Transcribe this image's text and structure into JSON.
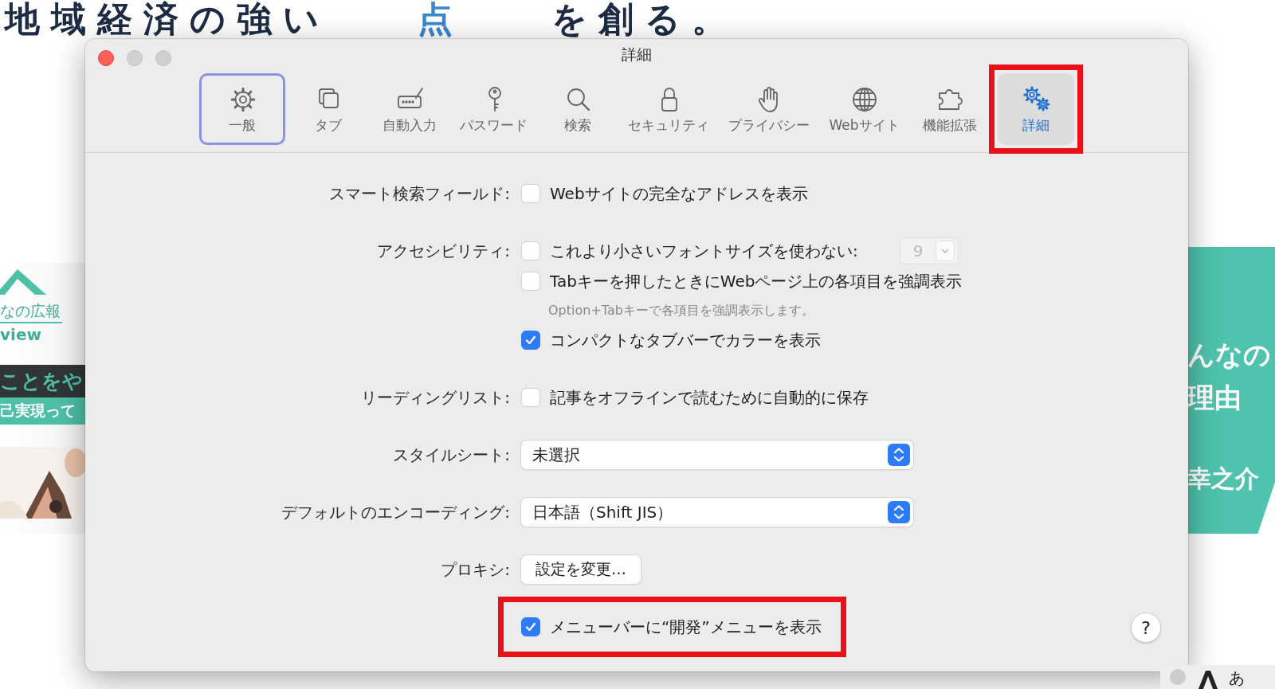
{
  "page": {
    "headline": [
      {
        "text": "地域経済の強い",
        "accent": false
      },
      {
        "text": "点",
        "accent": true
      },
      {
        "text": "を創る。",
        "accent": false
      }
    ],
    "left_banner": {
      "caption": "なの広報",
      "subcaption": "view",
      "band_dark": "ことをや",
      "band_teal": "己実現って"
    },
    "right_banner": {
      "lines": [
        "んなの",
        "理由",
        "幸之介"
      ]
    },
    "corner_panel": {
      "text": "あ"
    }
  },
  "window": {
    "title": "詳細"
  },
  "tabs": [
    {
      "label": "一般",
      "selected": false,
      "focused": true,
      "highlighted": false
    },
    {
      "label": "タブ",
      "selected": false,
      "focused": false,
      "highlighted": false
    },
    {
      "label": "自動入力",
      "selected": false,
      "focused": false,
      "highlighted": false
    },
    {
      "label": "パスワード",
      "selected": false,
      "focused": false,
      "highlighted": false
    },
    {
      "label": "検索",
      "selected": false,
      "focused": false,
      "highlighted": false
    },
    {
      "label": "セキュリティ",
      "selected": false,
      "focused": false,
      "highlighted": false
    },
    {
      "label": "プライバシー",
      "selected": false,
      "focused": false,
      "highlighted": false
    },
    {
      "label": "Webサイト",
      "selected": false,
      "focused": false,
      "highlighted": false
    },
    {
      "label": "機能拡張",
      "selected": false,
      "focused": false,
      "highlighted": false
    },
    {
      "label": "詳細",
      "selected": true,
      "focused": false,
      "highlighted": true
    }
  ],
  "settings": [
    {
      "label": "スマート検索フィールド:",
      "items": [
        {
          "kind": "checkbox",
          "text": "Webサイトの完全なアドレスを表示",
          "checked": false,
          "highlighted": false
        }
      ]
    },
    {
      "label": "アクセシビリティ:",
      "items": [
        {
          "kind": "checkbox",
          "text": "これより小さいフォントサイズを使わない:",
          "checked": false,
          "highlighted": false,
          "stepper": {
            "value": "9",
            "disabled": true
          }
        },
        {
          "kind": "checkbox",
          "text": "Tabキーを押したときにWebページ上の各項目を強調表示",
          "checked": false,
          "highlighted": false
        },
        {
          "kind": "hint",
          "text": "Option+Tabキーで各項目を強調表示します。"
        },
        {
          "kind": "checkbox",
          "text": "コンパクトなタブバーでカラーを表示",
          "checked": true,
          "highlighted": false
        }
      ]
    },
    {
      "label": "リーディングリスト:",
      "items": [
        {
          "kind": "checkbox",
          "text": "記事をオフラインで読むために自動的に保存",
          "checked": false,
          "highlighted": false
        }
      ]
    },
    {
      "label": "スタイルシート:",
      "items": [
        {
          "kind": "popup",
          "value": "未選択"
        }
      ]
    },
    {
      "label": "デフォルトのエンコーディング:",
      "items": [
        {
          "kind": "popup",
          "value": "日本語（Shift JIS）"
        }
      ]
    },
    {
      "label": "プロキシ:",
      "items": [
        {
          "kind": "button",
          "text": "設定を変更…"
        }
      ]
    },
    {
      "items": [
        {
          "kind": "checkbox",
          "text": "メニューバーに“開発”メニューを表示",
          "checked": true,
          "highlighted": true
        }
      ]
    }
  ],
  "help_button": {
    "text": "?"
  }
}
